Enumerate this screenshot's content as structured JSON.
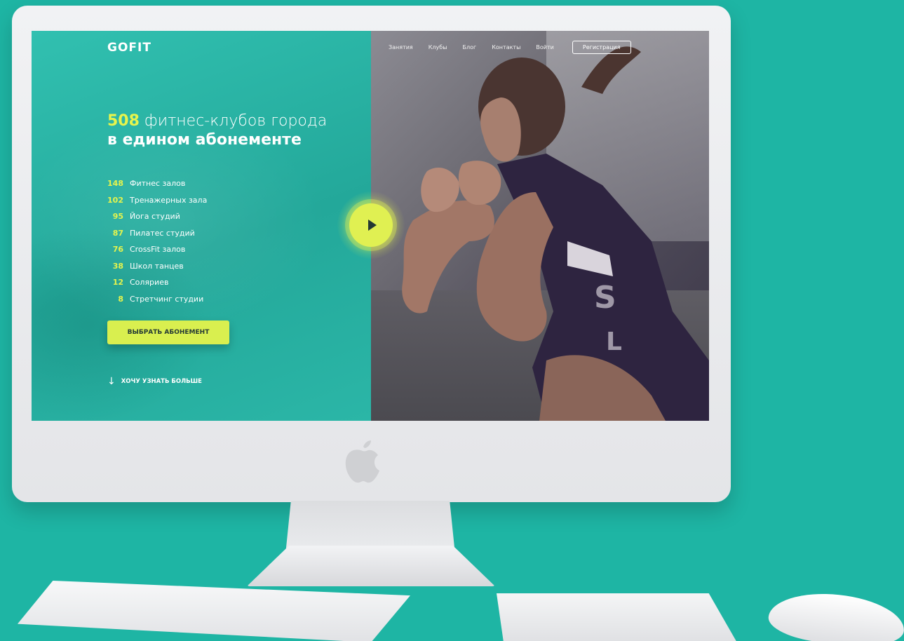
{
  "brand": {
    "logo": "GOFIT"
  },
  "nav": {
    "items": [
      "Занятия",
      "Клубы",
      "Блог",
      "Контакты",
      "Войти"
    ],
    "register_label": "Регистрация"
  },
  "hero": {
    "count": "508",
    "line1_rest": " фитнес-клубов города",
    "line2": "в едином абонементе"
  },
  "clubs": [
    {
      "count": "148",
      "label": "Фитнес залов"
    },
    {
      "count": "102",
      "label": "Тренажерных зала"
    },
    {
      "count": "95",
      "label": "Йога студий"
    },
    {
      "count": "87",
      "label": "Пилатес студий"
    },
    {
      "count": "76",
      "label": "CrossFit залов"
    },
    {
      "count": "38",
      "label": "Школ танцев"
    },
    {
      "count": "12",
      "label": "Соляриев"
    },
    {
      "count": "8",
      "label": "Стретчинг студии"
    }
  ],
  "cta": {
    "label": "ВЫБРАТЬ АБОНЕМЕНТ"
  },
  "more": {
    "label": "ХОЧУ УЗНАТЬ БОЛЬШЕ",
    "icon": "arrow-down-icon"
  },
  "play": {
    "icon": "play-icon"
  },
  "colors": {
    "background": "#1eb5a4",
    "accent": "#e0f052",
    "teal_panel": "#2bb7a9"
  }
}
